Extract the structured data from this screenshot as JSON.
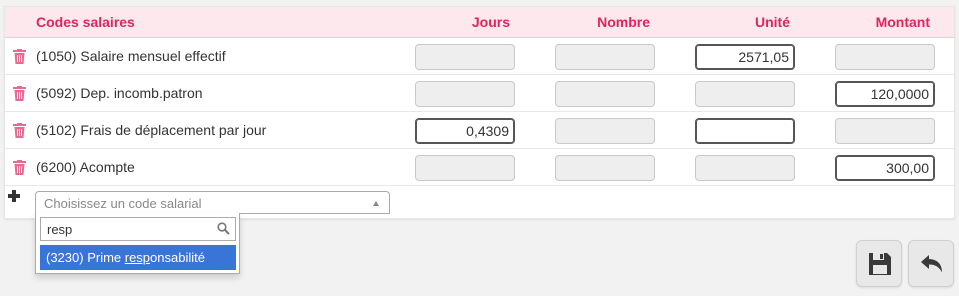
{
  "table": {
    "headers": {
      "code": "Codes salaires",
      "jours": "Jours",
      "nombre": "Nombre",
      "unite": "Unité",
      "montant": "Montant"
    },
    "rows": [
      {
        "label": "(1050) Salaire mensuel effectif",
        "jours": "",
        "nombre": "",
        "unite": "2571,05",
        "montant": ""
      },
      {
        "label": "(5092) Dep. incomb.patron",
        "jours": "",
        "nombre": "",
        "unite": "",
        "montant": "120,0000"
      },
      {
        "label": "(5102) Frais de déplacement par jour",
        "jours": "0,4309",
        "nombre": "",
        "unite": "",
        "montant": ""
      },
      {
        "label": "(6200) Acompte",
        "jours": "",
        "nombre": "",
        "unite": "",
        "montant": "300,00"
      }
    ],
    "row_icon": "trash-icon",
    "trash_color": "#e86a92"
  },
  "add_row": {
    "icon": "plus-icon",
    "select_placeholder": "Choisissez un code salarial",
    "search_value": "resp",
    "option_prefix": "(3230) Prime ",
    "option_match": "resp",
    "option_suffix": "onsabilité"
  },
  "actions": {
    "save_icon": "floppy-disk-icon",
    "back_icon": "undo-arrow-icon"
  },
  "colors": {
    "header_text": "#e0245e",
    "header_bg": "#fde8ee",
    "option_highlight": "#3875d7"
  }
}
